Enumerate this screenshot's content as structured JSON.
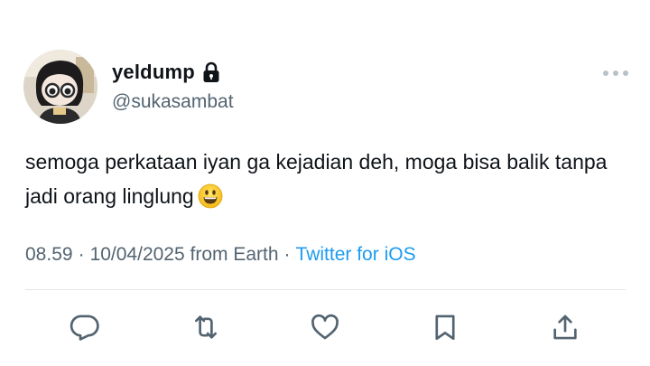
{
  "tweet": {
    "display_name": "yeldump",
    "handle": "@sukasambat",
    "protected_icon": "lock-icon",
    "text": "semoga perkataan iyan ga kejadian deh, moga bisa balik tanpa jadi orang linglung",
    "emoji": "grinning-face-emoji",
    "time": "08.59",
    "date": "10/04/2025",
    "location": "from Earth",
    "separator": "·",
    "source": "Twitter for iOS",
    "source_color": "#1d9bf0"
  },
  "actions": [
    {
      "icon": "reply-icon"
    },
    {
      "icon": "retweet-icon"
    },
    {
      "icon": "like-icon"
    },
    {
      "icon": "bookmark-icon"
    },
    {
      "icon": "share-icon"
    }
  ],
  "colors": {
    "text": "#0f1419",
    "secondary": "#536471",
    "divider": "#e1e6ea"
  }
}
